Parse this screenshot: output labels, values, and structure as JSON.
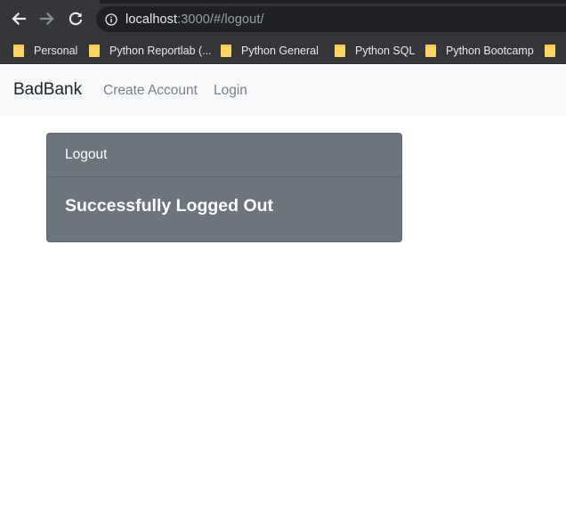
{
  "browser": {
    "url_host": "localhost",
    "url_rest": ":3000/#/logout/",
    "bookmarks": [
      {
        "label": "Personal"
      },
      {
        "label": "Python Reportlab (..."
      },
      {
        "label": "Python General"
      },
      {
        "label": "Python SQL"
      },
      {
        "label": "Python Bootcamp"
      },
      {
        "label": ""
      }
    ]
  },
  "navbar": {
    "brand": "BadBank",
    "links": [
      {
        "label": "Create Account"
      },
      {
        "label": "Login"
      }
    ]
  },
  "card": {
    "header": "Logout",
    "title": "Successfully Logged Out"
  },
  "colors": {
    "card_bg": "#6c757d",
    "navbar_bg": "#f8f9fa",
    "bookmark_folder": "#fdd663"
  }
}
